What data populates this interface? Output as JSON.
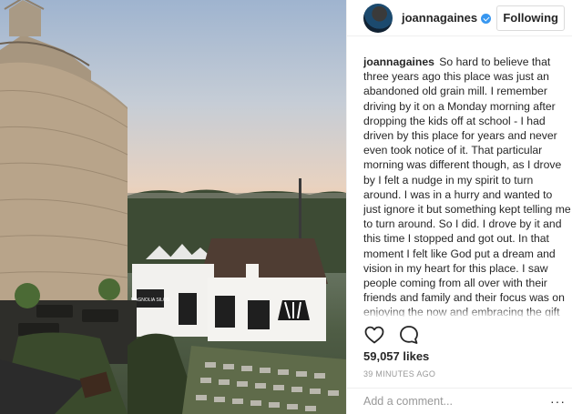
{
  "post": {
    "username": "joannagaines",
    "follow_label": "Following",
    "caption": "So hard to believe that three years ago this place was just an abandoned old grain mill. I remember driving by it on a Monday morning after dropping the kids off at school - I had driven by this place for years and never even took notice of it. That particular morning was different though, as I drove by I felt a nudge in my spirit to turn around. I was in a hurry and wanted to just ignore it but something kept telling me to turn around. So I did. I drove by it and this time I stopped and got out. In that moment I felt like God put a dream and vision in my heart for this place. I saw people coming from all over with their friends and family and their focus was on enjoying the now and embracing the gift of being together. I'm thankful to Chip for getting behind this \"God-sized\"",
    "likes": "59,057 likes",
    "timestamp": "39 MINUTES AGO",
    "comment_placeholder": "Add a comment...",
    "more_label": "···",
    "sign_text": "MAGNOLIA SILOS"
  },
  "icons": {
    "verified": "verified-badge-icon",
    "like": "heart-icon",
    "comment": "speech-bubble-icon",
    "more": "more-options-icon"
  },
  "colors": {
    "verified_blue": "#3897f0",
    "text": "#262626",
    "muted": "#999999",
    "border": "#dbdbdb"
  }
}
